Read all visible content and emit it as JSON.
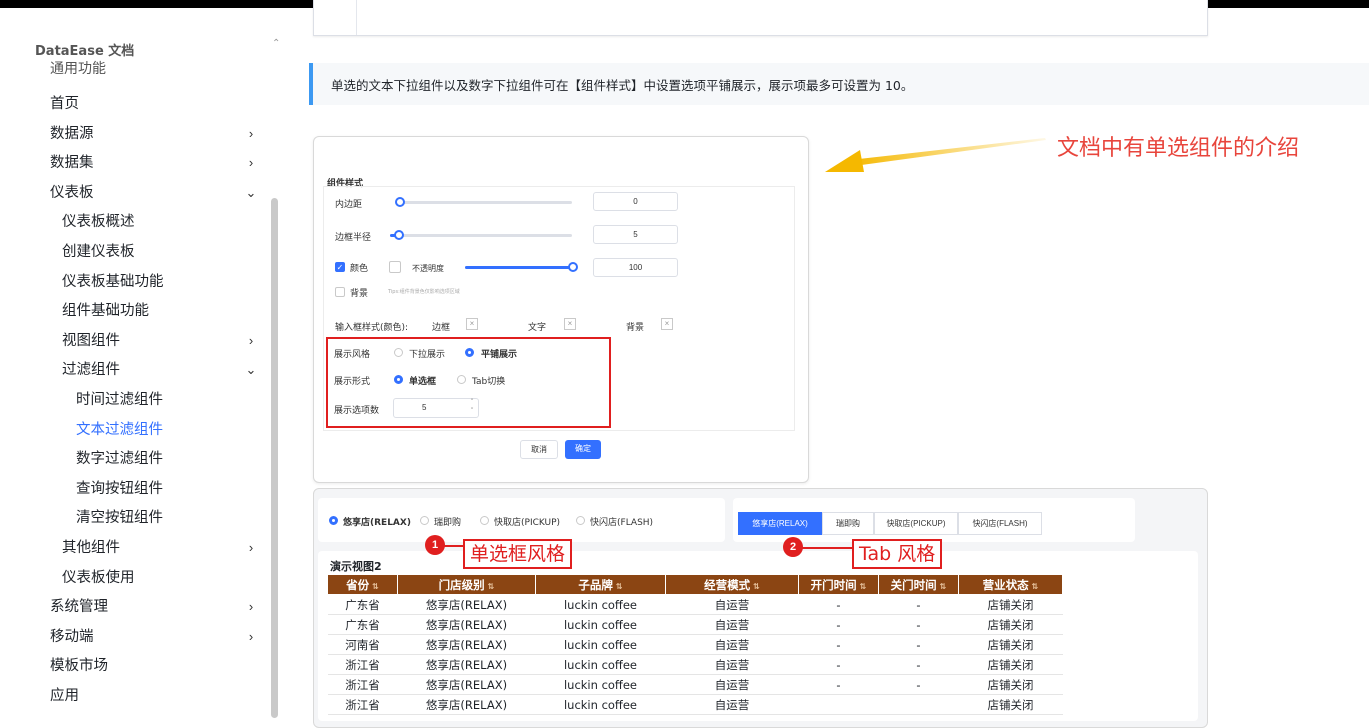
{
  "topbar": {
    "title": ""
  },
  "sidebar": {
    "brand": "DataEase 文档",
    "cut_item": "通用功能",
    "items": [
      {
        "label": "首页",
        "arrow": ""
      },
      {
        "label": "数据源",
        "arrow": "›"
      },
      {
        "label": "数据集",
        "arrow": "›"
      },
      {
        "label": "仪表板",
        "arrow": "⌄"
      },
      {
        "label": "仪表板概述",
        "arrow": ""
      },
      {
        "label": "创建仪表板",
        "arrow": ""
      },
      {
        "label": "仪表板基础功能",
        "arrow": ""
      },
      {
        "label": "组件基础功能",
        "arrow": ""
      },
      {
        "label": "视图组件",
        "arrow": "›"
      },
      {
        "label": "过滤组件",
        "arrow": "⌄"
      },
      {
        "label": "时间过滤组件",
        "arrow": ""
      },
      {
        "label": "文本过滤组件",
        "arrow": ""
      },
      {
        "label": "数字过滤组件",
        "arrow": ""
      },
      {
        "label": "查询按钮组件",
        "arrow": ""
      },
      {
        "label": "清空按钮组件",
        "arrow": ""
      },
      {
        "label": "其他组件",
        "arrow": "›"
      },
      {
        "label": "仪表板使用",
        "arrow": ""
      },
      {
        "label": "系统管理",
        "arrow": "›"
      },
      {
        "label": "移动端",
        "arrow": "›"
      },
      {
        "label": "模板市场",
        "arrow": ""
      },
      {
        "label": "应用",
        "arrow": ""
      }
    ],
    "active": "文本过滤组件"
  },
  "note": {
    "text": "单选的文本下拉组件以及数字下拉组件可在【组件样式】中设置选项平铺展示，展示项最多可设置为 10。"
  },
  "callout": {
    "text": "文档中有单选组件的介绍"
  },
  "style_panel": {
    "title": "组件样式",
    "padding_label": "内边距",
    "padding_value": "0",
    "padding_pct": 0.0,
    "radius_label": "边框半径",
    "radius_value": "5",
    "radius_pct": 0.05,
    "color_label": "颜色",
    "opacity_label": "不透明度",
    "opacity_value": "100",
    "opacity_pct": 1.0,
    "bg_label": "背景",
    "bg_hint": "Tips:组件背景色仅影响选项区域",
    "input_style_label": "输入框样式(颜色):",
    "border_label": "边框",
    "text_label": "文字",
    "bg2_label": "背景",
    "display_style_label": "展示风格",
    "dropdown_label": "下拉展示",
    "tile_label": "平铺展示",
    "display_form_label": "展示形式",
    "radio_label": "单选框",
    "tab_label": "Tab切换",
    "count_label": "展示选项数",
    "count_value": "5",
    "cancel": "取消",
    "confirm": "确定"
  },
  "demo": {
    "radio_options": [
      "悠享店(RELAX)",
      "瑞即购",
      "快取店(PICKUP)",
      "快闪店(FLASH)"
    ],
    "tab_options": [
      "悠享店(RELAX)",
      "瑞即购",
      "快取店(PICKUP)",
      "快闪店(FLASH)"
    ],
    "badge1": "1",
    "tag1": "单选框风格",
    "badge2": "2",
    "tag2": "Tab 风格",
    "view_title": "演示视图2",
    "columns": [
      "省份",
      "门店级别",
      "子品牌",
      "经营模式",
      "开门时间",
      "关门时间",
      "营业状态"
    ],
    "rows": [
      [
        "广东省",
        "悠享店(RELAX)",
        "luckin coffee",
        "自运营",
        "-",
        "-",
        "店铺关闭"
      ],
      [
        "广东省",
        "悠享店(RELAX)",
        "luckin coffee",
        "自运营",
        "-",
        "-",
        "店铺关闭"
      ],
      [
        "河南省",
        "悠享店(RELAX)",
        "luckin coffee",
        "自运营",
        "-",
        "-",
        "店铺关闭"
      ],
      [
        "浙江省",
        "悠享店(RELAX)",
        "luckin coffee",
        "自运营",
        "-",
        "-",
        "店铺关闭"
      ],
      [
        "浙江省",
        "悠享店(RELAX)",
        "luckin coffee",
        "自运营",
        "-",
        "-",
        "店铺关闭"
      ],
      [
        "浙江省",
        "悠享店(RELAX)",
        "luckin coffee",
        "自运营",
        "",
        "",
        "店铺关闭"
      ]
    ]
  },
  "colors": {
    "accent": "#3370ff",
    "annotation_red": "#e01f1f",
    "table_header": "#8b4513",
    "arrow": "#f5b800"
  }
}
